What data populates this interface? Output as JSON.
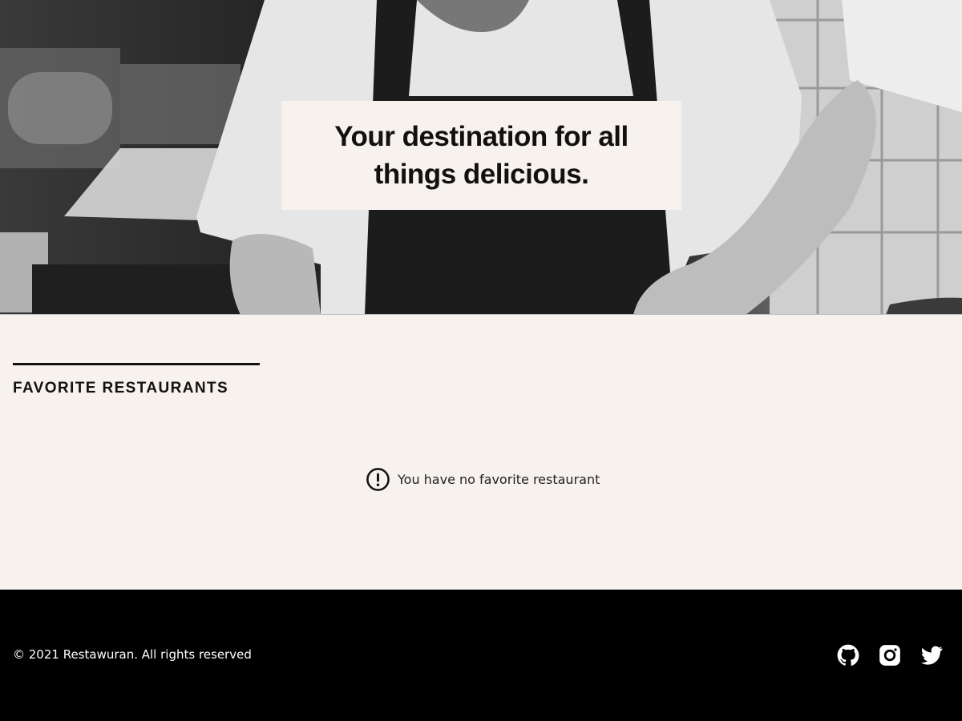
{
  "hero": {
    "tagline": "Your destination for all things delicious."
  },
  "favorites": {
    "section_title": "FAVORITE RESTAURANTS",
    "empty_message": "You have no favorite restaurant",
    "empty_icon": "exclamation-circle-icon"
  },
  "footer": {
    "copyright": "© 2021 Restawuran. All rights reserved",
    "social": [
      {
        "icon": "github-icon"
      },
      {
        "icon": "instagram-icon"
      },
      {
        "icon": "twitter-icon"
      }
    ]
  },
  "colors": {
    "background": "#f7f2ee",
    "footer": "#000000",
    "text": "#111111"
  }
}
